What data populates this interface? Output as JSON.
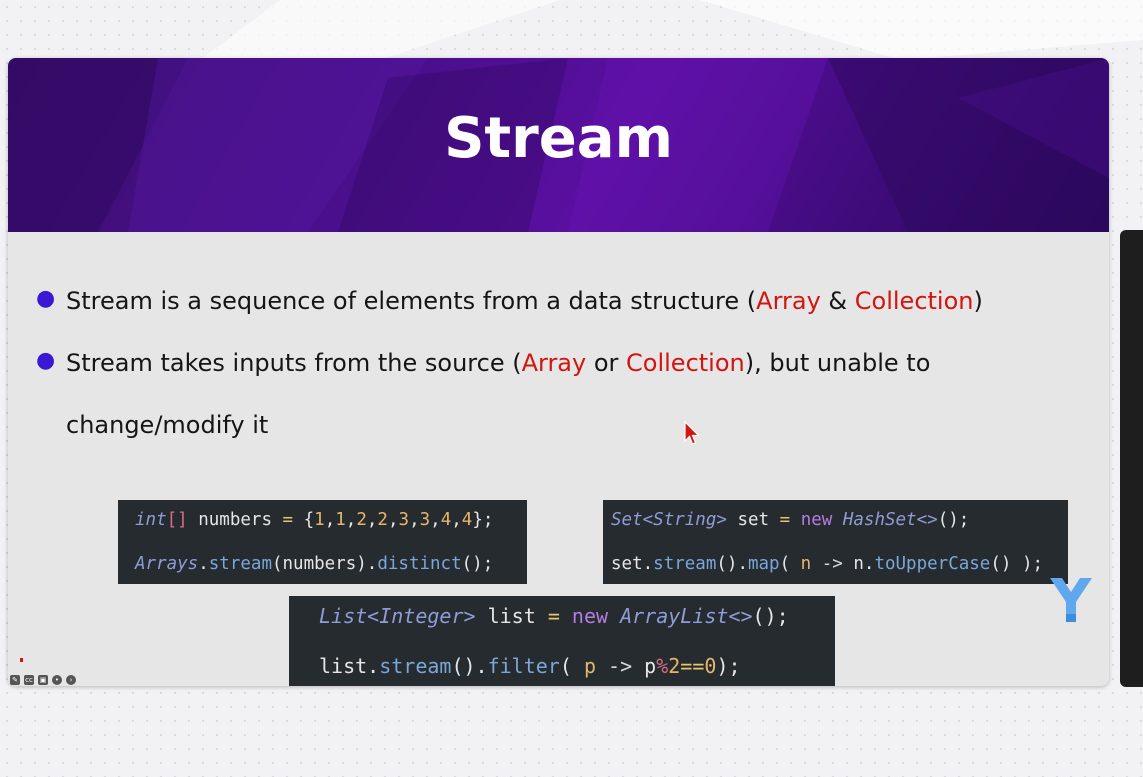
{
  "slide": {
    "title": "Stream",
    "bullets": [
      {
        "parts": [
          "Stream is a sequence of elements from a data structure (",
          "Array",
          " & ",
          "Collection",
          ")"
        ]
      },
      {
        "parts": [
          "Stream takes inputs from the source (",
          "Array",
          " or ",
          "Collection",
          "), but unable to"
        ],
        "continuation": "change/modify it"
      }
    ]
  },
  "code_blocks": {
    "array_example": {
      "line1": [
        "int",
        "[]",
        " numbers ",
        "=",
        " {",
        "1",
        ",",
        "1",
        ",",
        "2",
        ",",
        "2",
        ",",
        "3",
        ",",
        "3",
        ",",
        "4",
        ",",
        "4",
        "};"
      ],
      "line2": [
        "Arrays",
        ".",
        "stream",
        "(numbers).",
        "distinct",
        "();"
      ]
    },
    "set_example": {
      "line1": [
        "Set",
        "<",
        "String",
        ">",
        " set ",
        "=",
        " new ",
        "HashSet",
        "<>",
        "();"
      ],
      "line2": [
        "set.",
        "stream",
        "().",
        "map",
        "( ",
        "n",
        " -> ",
        "n.",
        "toUpperCase",
        "() );"
      ]
    },
    "list_example": {
      "line1": [
        "List",
        "<",
        "Integer",
        ">",
        " list ",
        "=",
        " new ",
        "ArrayList",
        "<>",
        "();"
      ],
      "line2": [
        "list.",
        "stream",
        "().",
        "filter",
        "( ",
        "p",
        " -> ",
        "p",
        "%",
        "2",
        "==",
        "0",
        ");"
      ]
    }
  },
  "colors": {
    "header_purple": "#4a0f8c",
    "bullet_dot": "#3a18d6",
    "highlight_red": "#d3150f",
    "code_bg": "#262b30",
    "logo_blue": "#5fa8f0"
  },
  "icons": {
    "toolbar": [
      "pen-icon",
      "caption-icon",
      "camera-off-icon",
      "more-icon",
      "next-icon"
    ],
    "cursor": "mouse-pointer-icon",
    "logo": "y-logo-icon"
  }
}
